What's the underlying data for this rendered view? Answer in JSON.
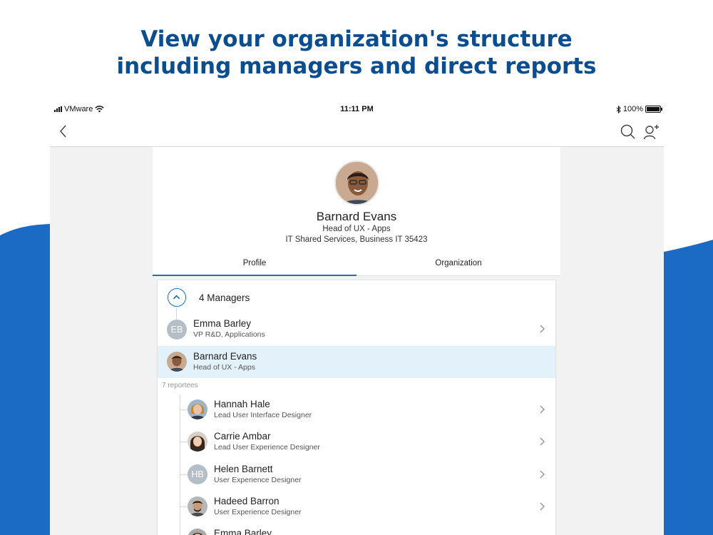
{
  "headline": {
    "line1": "View your organization's structure",
    "line2": "including managers and direct reports"
  },
  "colors": {
    "brand_blue": "#1565c0",
    "headline": "#0c4d8f",
    "accent": "#1f6fbf",
    "selected_row": "#e3f2fa"
  },
  "statusbar": {
    "carrier": "VMware",
    "time": "11:11 PM",
    "battery": "100%",
    "battery_level": 1.0
  },
  "navbar": {
    "back_icon": "chevron-left-icon",
    "search_icon": "search-icon",
    "add_icon": "add-user-icon"
  },
  "profile": {
    "name": "Barnard Evans",
    "title": "Head of UX - Apps",
    "department": "IT Shared Services, Business IT 35423",
    "tabs": [
      {
        "label": "Profile",
        "active": true
      },
      {
        "label": "Organization",
        "active": false
      }
    ]
  },
  "managers": {
    "header": "4 Managers",
    "items": [
      {
        "initials": "EB",
        "name": "Emma Barley",
        "role": "VP R&D, Applications",
        "selected": false
      },
      {
        "initials": "",
        "name": "Barnard Evans",
        "role": "Head of UX - Apps",
        "selected": true
      }
    ]
  },
  "reportees": {
    "label": "7 reportees",
    "items": [
      {
        "initials": "",
        "name": "Hannah Hale",
        "role": "Lead User Interface Designer"
      },
      {
        "initials": "",
        "name": "Carrie Ambar",
        "role": "Lead User Experience Designer"
      },
      {
        "initials": "HB",
        "name": "Helen Barnett",
        "role": "User Experience Designer"
      },
      {
        "initials": "",
        "name": "Hadeed Barron",
        "role": "User Experience Designer"
      },
      {
        "initials": "",
        "name": "Emma Barley",
        "role": ""
      }
    ]
  }
}
